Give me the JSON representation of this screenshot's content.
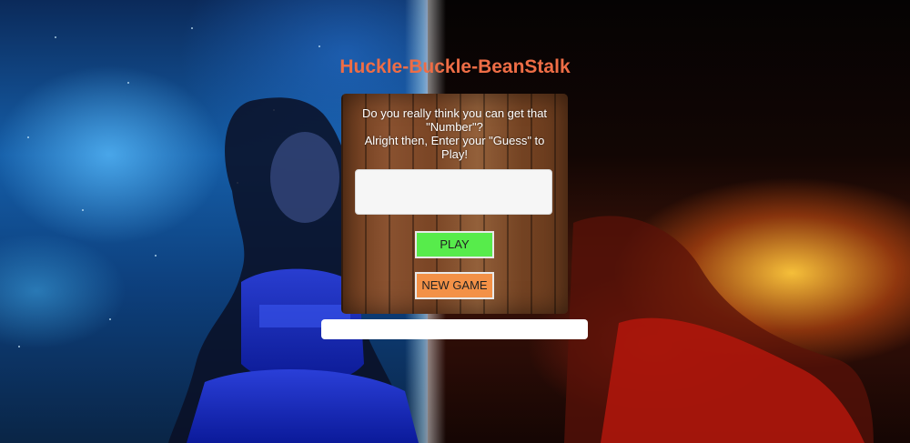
{
  "game": {
    "title": "Huckle-Buckle-BeanStalk",
    "prompt_line1": "Do you really think you can get that \"Number\"?",
    "prompt_line2": "Alright then, Enter your \"Guess\" to Play!",
    "guess_input": {
      "value": "",
      "placeholder": ""
    },
    "play_label": "PLAY",
    "new_game_label": "NEW GAME",
    "result_text": ""
  },
  "colors": {
    "title": "#ee6d46",
    "play_button": "#57ec4b",
    "new_game_button": "#f39147",
    "panel_wood": "#7a4525"
  },
  "background": {
    "left_theme": "blue night sky with woman in blue dress",
    "right_theme": "fiery orange sunset with figure in red dress"
  }
}
